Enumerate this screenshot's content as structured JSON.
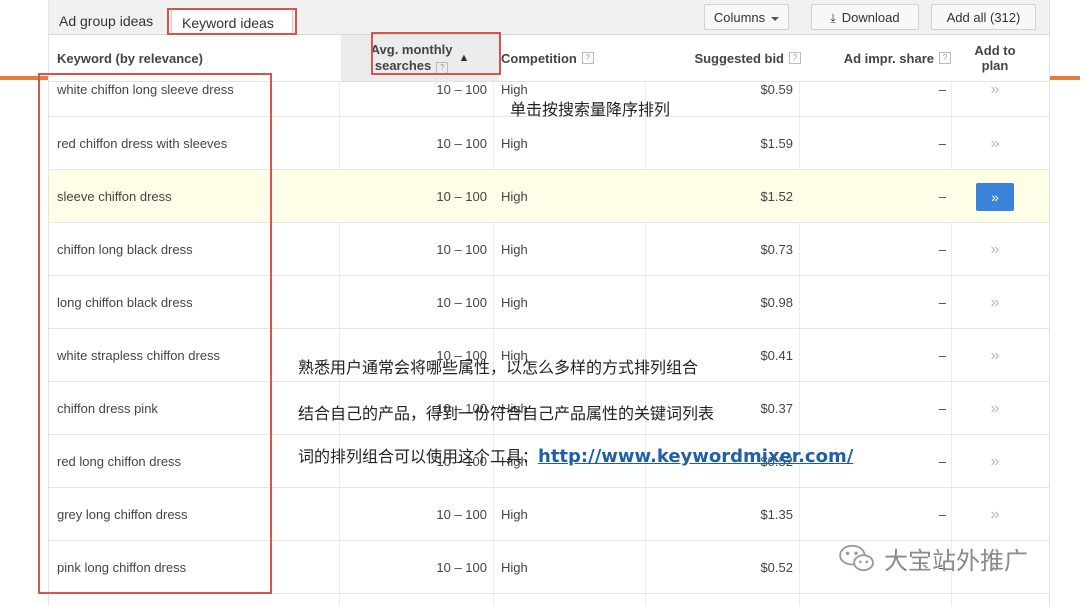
{
  "tabs": {
    "ad_group": "Ad group ideas",
    "keyword": "Keyword ideas"
  },
  "toolbar": {
    "columns": "Columns",
    "download": "Download",
    "add_all": "Add all (312)"
  },
  "columns": {
    "keyword": "Keyword (by relevance)",
    "avg_line1": "Avg. monthly",
    "avg_line2": "searches",
    "competition": "Competition",
    "bid": "Suggested bid",
    "adimpr": "Ad impr. share",
    "plan_line1": "Add to",
    "plan_line2": "plan"
  },
  "rows": [
    {
      "keyword": "white chiffon long sleeve dress",
      "avg": "10 – 100",
      "competition": "High",
      "bid": "$0.59",
      "adimpr": "–"
    },
    {
      "keyword": "red chiffon dress with sleeves",
      "avg": "10 – 100",
      "competition": "High",
      "bid": "$1.59",
      "adimpr": "–"
    },
    {
      "keyword": "sleeve chiffon dress",
      "avg": "10 – 100",
      "competition": "High",
      "bid": "$1.52",
      "adimpr": "–"
    },
    {
      "keyword": "chiffon long black dress",
      "avg": "10 – 100",
      "competition": "High",
      "bid": "$0.73",
      "adimpr": "–"
    },
    {
      "keyword": "long chiffon black dress",
      "avg": "10 – 100",
      "competition": "High",
      "bid": "$0.98",
      "adimpr": "–"
    },
    {
      "keyword": "white strapless chiffon dress",
      "avg": "10 – 100",
      "competition": "High",
      "bid": "$0.41",
      "adimpr": "–"
    },
    {
      "keyword": "chiffon dress pink",
      "avg": "10 – 100",
      "competition": "High",
      "bid": "$0.37",
      "adimpr": "–"
    },
    {
      "keyword": "red long chiffon dress",
      "avg": "10 – 100",
      "competition": "High",
      "bid": "$0.52",
      "adimpr": "–"
    },
    {
      "keyword": "grey long chiffon dress",
      "avg": "10 – 100",
      "competition": "High",
      "bid": "$1.35",
      "adimpr": "–"
    },
    {
      "keyword": "pink long chiffon dress",
      "avg": "10 – 100",
      "competition": "High",
      "bid": "$0.52",
      "adimpr": "–"
    }
  ],
  "plan_glyph": "»",
  "annotations": {
    "sort_note": "单击按搜索量降序排列",
    "line1": "熟悉用户通常会将哪些属性，以怎么多样的方式排列组合",
    "line2": "结合自己的产品，得到一份符合自己产品属性的关键词列表",
    "line3": "词的排列组合可以使用这个工具：",
    "link": "http://www.keywordmixer.com/"
  },
  "watermark": "大宝站外推广",
  "colors": {
    "accent_red": "#d9534f",
    "accent_orange": "#e87a3a",
    "plan_button": "#3b82db",
    "link": "#1f5fa8"
  },
  "icons": {
    "download": "download-icon",
    "sort": "sort-up-icon",
    "help": "help-icon",
    "plan": "double-chevron-right-icon",
    "watermark": "wechat-icon"
  }
}
